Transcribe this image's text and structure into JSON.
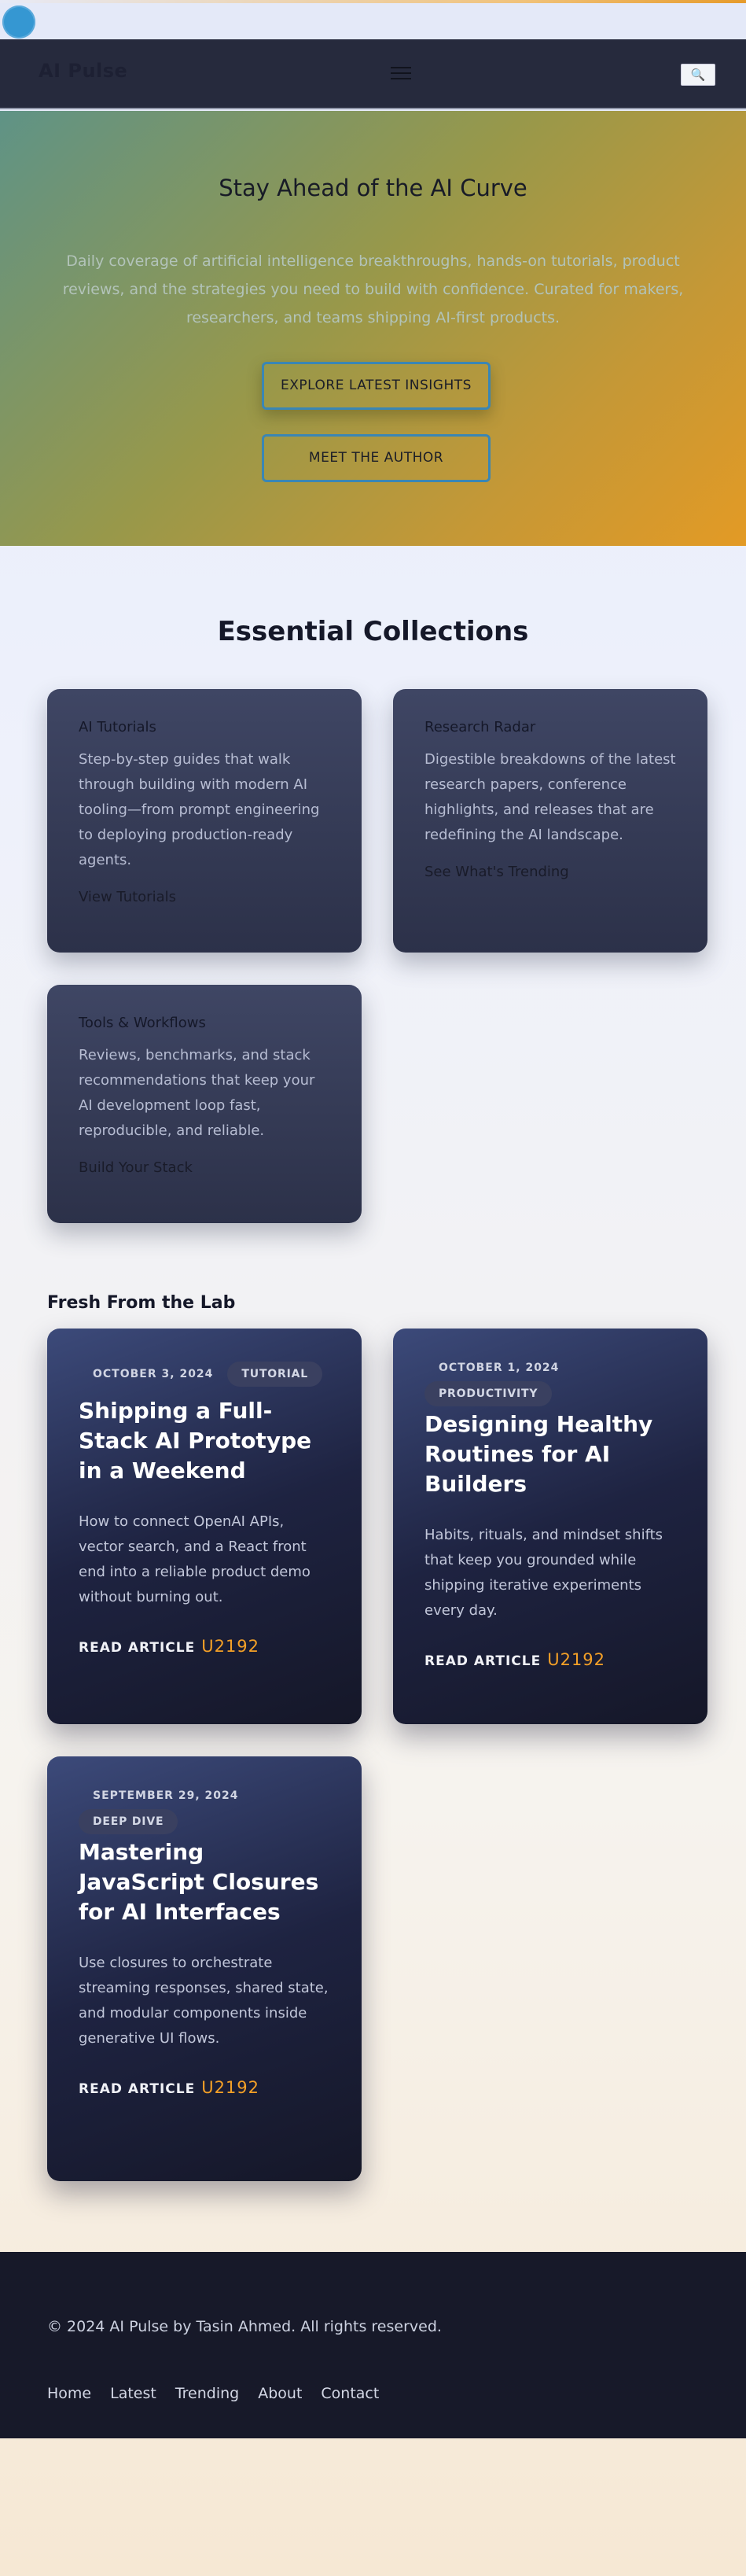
{
  "site": {
    "brand": "AI Pulse",
    "search_icon": "🔍"
  },
  "hero": {
    "title": "Stay Ahead of the AI Curve",
    "subtitle": "Daily coverage of artificial intelligence breakthroughs, hands-on tutorials, product reviews, and the strategies you need to build with confidence. Curated for makers, researchers, and teams shipping AI-first products.",
    "primary_cta": "EXPLORE LATEST INSIGHTS",
    "secondary_cta": "MEET THE AUTHOR"
  },
  "collections": {
    "title": "Essential Collections",
    "items": [
      {
        "title": "AI Tutorials",
        "description": "Step-by-step guides that walk through building with modern AI tooling—from prompt engineering to deploying production-ready agents.",
        "link": "View Tutorials"
      },
      {
        "title": "Research Radar",
        "description": "Digestible breakdowns of the latest research papers, conference highlights, and releases that are redefining the AI landscape.",
        "link": "See What's Trending"
      },
      {
        "title": "Tools & Workflows",
        "description": "Reviews, benchmarks, and stack recommendations that keep your AI development loop fast, reproducible, and reliable.",
        "link": "Build Your Stack"
      }
    ]
  },
  "fresh": {
    "title": "Fresh From the Lab",
    "posts": [
      {
        "date": "OCTOBER 3, 2024",
        "tag": "TUTORIAL",
        "title": "Shipping a Full-Stack AI Prototype in a Weekend",
        "excerpt": "How to connect OpenAI APIs, vector search, and a React front end into a reliable product demo without burning out.",
        "read": "READ ARTICLE",
        "arrow": "U2192"
      },
      {
        "date": "OCTOBER 1, 2024",
        "tag": "PRODUCTIVITY",
        "title": "Designing Healthy Routines for AI Builders",
        "excerpt": "Habits, rituals, and mindset shifts that keep you grounded while shipping iterative experiments every day.",
        "read": "READ ARTICLE",
        "arrow": "U2192"
      },
      {
        "date": "SEPTEMBER 29, 2024",
        "tag": "DEEP DIVE",
        "title": "Mastering JavaScript Closures for AI Interfaces",
        "excerpt": "Use closures to orchestrate streaming responses, shared state, and modular components inside generative UI flows.",
        "read": "READ ARTICLE",
        "arrow": "U2192"
      }
    ]
  },
  "footer": {
    "copyright": "© 2024 AI Pulse by Tasin Ahmed. All rights reserved.",
    "links": [
      "Home",
      "Latest",
      "Trending",
      "About",
      "Contact"
    ]
  }
}
